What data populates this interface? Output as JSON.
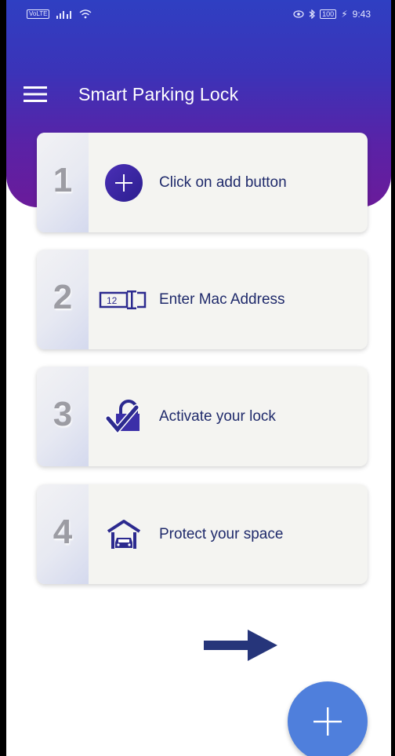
{
  "status_bar": {
    "volte": "VoLTE",
    "battery": "100",
    "time": "9:43"
  },
  "app_bar": {
    "title": "Smart Parking Lock",
    "menu_icon": "hamburger-menu-icon"
  },
  "steps": [
    {
      "number": "1",
      "label": "Click on add button",
      "icon": "add-circle-icon"
    },
    {
      "number": "2",
      "label": "Enter Mac Address",
      "icon": "text-input-icon",
      "icon_text": "12"
    },
    {
      "number": "3",
      "label": "Activate your lock",
      "icon": "lock-check-icon"
    },
    {
      "number": "4",
      "label": "Protect your space",
      "icon": "garage-car-icon"
    }
  ],
  "fab": {
    "icon": "plus-icon"
  },
  "colors": {
    "header_top": "#2f3fc2",
    "header_bottom": "#6a1b9a",
    "accent_dark": "#2c2a8f",
    "fab": "#4f7fdc",
    "arrow": "#26357a",
    "card_bg": "#f4f4f1",
    "number_gray": "#9c9ca3"
  }
}
